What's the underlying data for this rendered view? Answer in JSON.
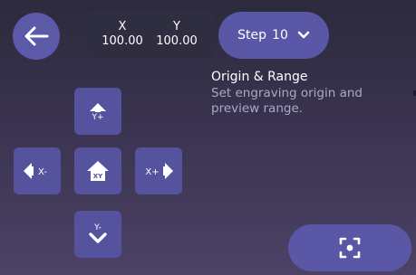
{
  "coords": {
    "x_label": "X",
    "y_label": "Y",
    "x_value": "100.00",
    "y_value": "100.00"
  },
  "step": {
    "label": "Step",
    "value": "10"
  },
  "info": {
    "title": "Origin & Range",
    "description": "Set engraving origin and preview range."
  },
  "jog": {
    "up_label": "Y+",
    "down_label": "Y-",
    "left_label": "X-",
    "right_label": "X+",
    "home_label": "XY"
  },
  "icons": {
    "back": "arrow-left-icon",
    "step_dropdown": "chevron-down-icon",
    "focus": "focus-target-icon",
    "home": "home-icon"
  },
  "colors": {
    "button": "#5a58a6",
    "coord_bg": "#2f2d40",
    "description": "#aaa7c8"
  }
}
